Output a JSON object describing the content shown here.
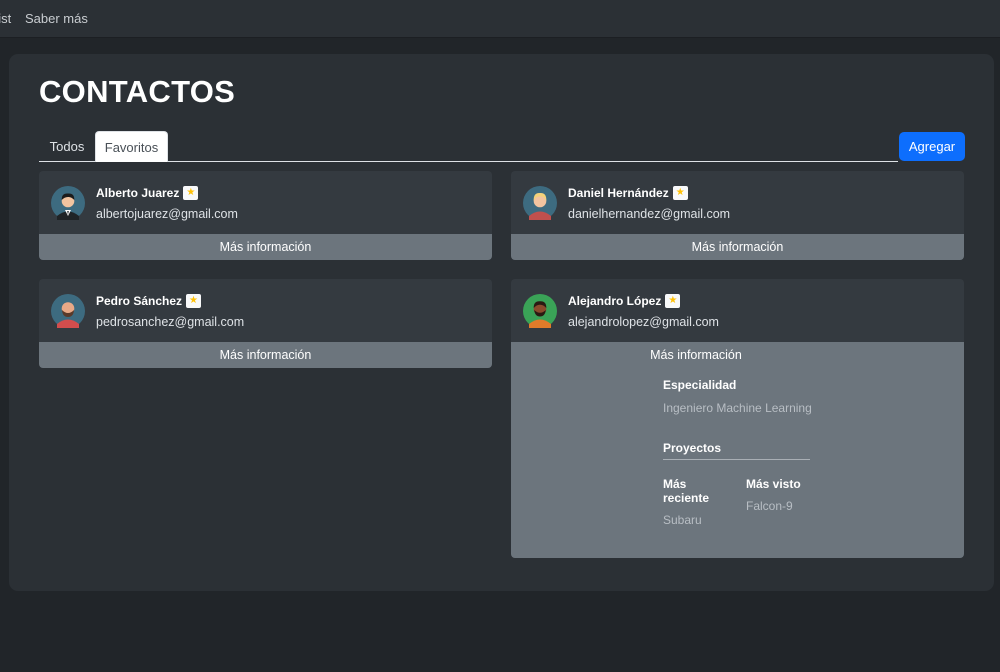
{
  "nav": {
    "links": [
      "List",
      "Saber más"
    ]
  },
  "page": {
    "title": "CONTACTOS"
  },
  "tabs": [
    {
      "label": "Todos",
      "active": false
    },
    {
      "label": "Favoritos",
      "active": true
    }
  ],
  "add_button": "Agregar",
  "contacts": [
    {
      "name": "Alberto Juarez",
      "email": "albertojuarez@gmail.com",
      "favorite": true,
      "more": "Más información",
      "avatar": "man-suit-avatar-icon"
    },
    {
      "name": "Daniel Hernández",
      "email": "danielhernandez@gmail.com",
      "favorite": true,
      "more": "Más información",
      "avatar": "blond-man-avatar-icon"
    },
    {
      "name": "Pedro Sánchez",
      "email": "pedrosanchez@gmail.com",
      "favorite": true,
      "more": "Más información",
      "avatar": "bald-bearded-man-avatar-icon"
    },
    {
      "name": "Alejandro López",
      "email": "alejandrolopez@gmail.com",
      "favorite": true,
      "more": "Más información",
      "avatar": "dark-skin-man-avatar-icon"
    }
  ],
  "details": {
    "especialidad_label": "Especialidad",
    "especialidad_value": "Ingeniero Machine Learning",
    "proyectos_label": "Proyectos",
    "mas_reciente_label": "Más reciente",
    "mas_reciente_value": "Subaru",
    "mas_visto_label": "Más visto",
    "mas_visto_value": "Falcon-9"
  },
  "colors": {
    "background": "#212529",
    "panel": "#2b3035",
    "card": "#343a40",
    "card_footer": "#6c757d",
    "primary": "#0d6efd",
    "star": "#ffc107"
  }
}
